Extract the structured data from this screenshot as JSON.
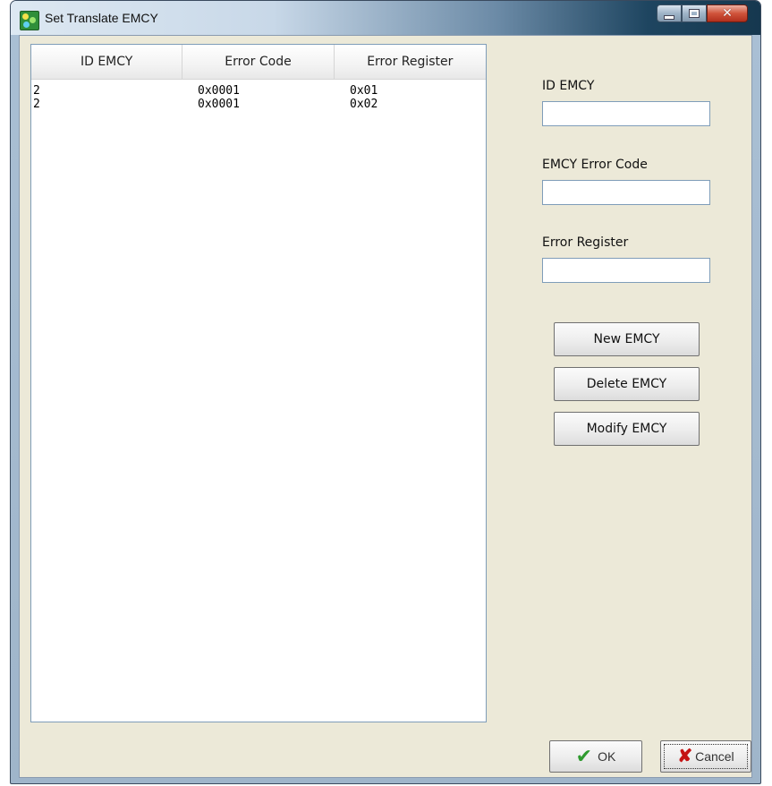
{
  "window": {
    "title": "Set Translate EMCY"
  },
  "table": {
    "columns": [
      "ID EMCY",
      "Error Code",
      "Error Register"
    ],
    "rows": [
      [
        "2",
        "0x0001",
        "0x01"
      ],
      [
        "2",
        "0x0001",
        "0x02"
      ]
    ]
  },
  "form": {
    "id_label": "ID EMCY",
    "id_value": "",
    "code_label": "EMCY Error Code",
    "code_value": "",
    "register_label": "Error Register",
    "register_value": ""
  },
  "actions": {
    "new": "New EMCY",
    "delete": "Delete EMCY",
    "modify": "Modify EMCY"
  },
  "dialog": {
    "ok": "OK",
    "cancel": "Cancel"
  },
  "icons": {
    "ok": "check-icon",
    "cancel": "x-icon"
  },
  "colors": {
    "titlebar_dark": "#16384f",
    "close_red": "#c8452f",
    "ok_green": "#2e9a2e",
    "cancel_red": "#c51414"
  }
}
